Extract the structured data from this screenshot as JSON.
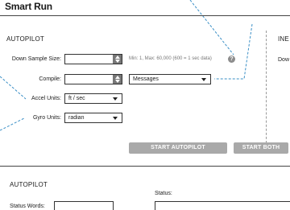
{
  "header": {
    "title": "Smart Run"
  },
  "autopilot": {
    "heading": "AUTOPILOT",
    "down_sample": {
      "label": "Down Sample Size:",
      "value": "",
      "hint": "Min: 1, Max: 60,000  (600 = 1 sec data)",
      "help": "?"
    },
    "compile": {
      "label": "Compile:",
      "value": "",
      "mode_selected": "Messages"
    },
    "accel_units": {
      "label": "Accel Units:",
      "selected": "ft / sec"
    },
    "gyro_units": {
      "label": "Gyro Units:",
      "selected": "radian"
    }
  },
  "right_panel": {
    "heading": "INE",
    "label": "Dow"
  },
  "buttons": {
    "start_autopilot": "START AUTOPILOT",
    "start_both": "START BOTH"
  },
  "status_section": {
    "heading": "AUTOPILOT",
    "status_label": "Status:",
    "status_words_label": "Status Words:"
  }
}
